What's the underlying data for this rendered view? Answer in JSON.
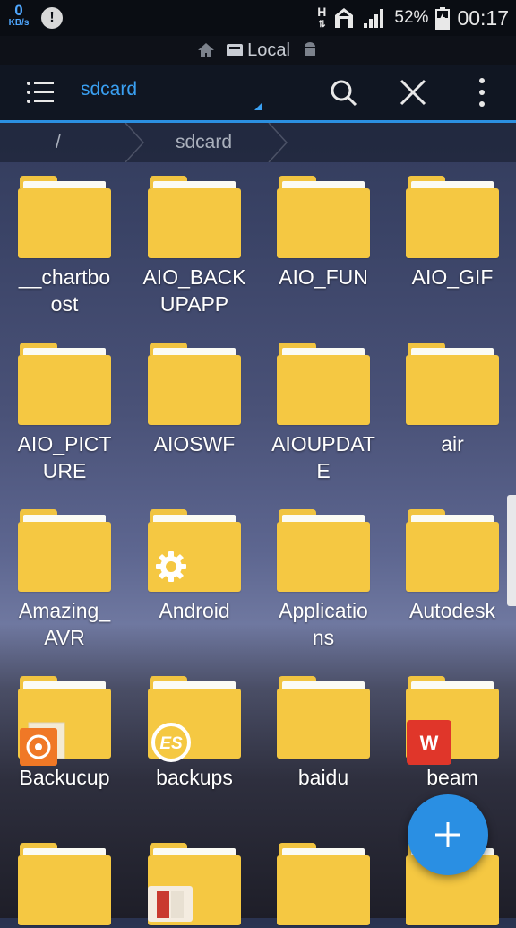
{
  "status_bar": {
    "net_speed_value": "0",
    "net_speed_unit": "KB/s",
    "network_type": "H",
    "battery_percent": "52%",
    "time": "00:17",
    "icons": [
      "info-icon",
      "home-icon",
      "signal-icon",
      "battery-icon"
    ]
  },
  "title_bar": {
    "label": "Local"
  },
  "toolbar": {
    "path": "sdcard"
  },
  "breadcrumb": {
    "root": "/",
    "current": "sdcard"
  },
  "files": [
    {
      "name": "__chartboost",
      "lines": [
        "__chartbo",
        "ost"
      ],
      "overlay": ""
    },
    {
      "name": "AIO_BACKUPAPP",
      "lines": [
        "AIO_BACK",
        "UPAPP"
      ],
      "overlay": ""
    },
    {
      "name": "AIO_FUN",
      "lines": [
        "AIO_FUN"
      ],
      "overlay": ""
    },
    {
      "name": "AIO_GIF",
      "lines": [
        "AIO_GIF"
      ],
      "overlay": ""
    },
    {
      "name": "AIO_PICTURE",
      "lines": [
        "AIO_PICT",
        "URE"
      ],
      "overlay": ""
    },
    {
      "name": "AIOSWF",
      "lines": [
        "AIOSWF"
      ],
      "overlay": ""
    },
    {
      "name": "AIOUPDATE",
      "lines": [
        "AIOUPDAT",
        "E"
      ],
      "overlay": ""
    },
    {
      "name": "air",
      "lines": [
        "air"
      ],
      "overlay": ""
    },
    {
      "name": "Amazing_AVR",
      "lines": [
        "Amazing_",
        "AVR"
      ],
      "overlay": ""
    },
    {
      "name": "Android",
      "lines": [
        "Android"
      ],
      "overlay": "gear-icon"
    },
    {
      "name": "Applications",
      "lines": [
        "Applicatio",
        "ns"
      ],
      "overlay": ""
    },
    {
      "name": "Autodesk",
      "lines": [
        "Autodesk"
      ],
      "overlay": ""
    },
    {
      "name": "Backucup",
      "lines": [
        "Backucup"
      ],
      "overlay": "uc-browser-icon"
    },
    {
      "name": "backups",
      "lines": [
        "backups"
      ],
      "overlay": "es-explorer-icon"
    },
    {
      "name": "baidu",
      "lines": [
        "baidu"
      ],
      "overlay": ""
    },
    {
      "name": "beam",
      "lines": [
        "beam"
      ],
      "overlay": "wps-office-icon"
    },
    {
      "name": "",
      "lines": [],
      "overlay": ""
    },
    {
      "name": "",
      "lines": [],
      "overlay": "book-icon"
    },
    {
      "name": "",
      "lines": [],
      "overlay": ""
    },
    {
      "name": "",
      "lines": [],
      "overlay": ""
    }
  ],
  "colors": {
    "accent": "#2b8fe0",
    "folder": "#f5c842",
    "toolbar_bg": "#101622",
    "statusbar_bg": "#0a0d13"
  }
}
